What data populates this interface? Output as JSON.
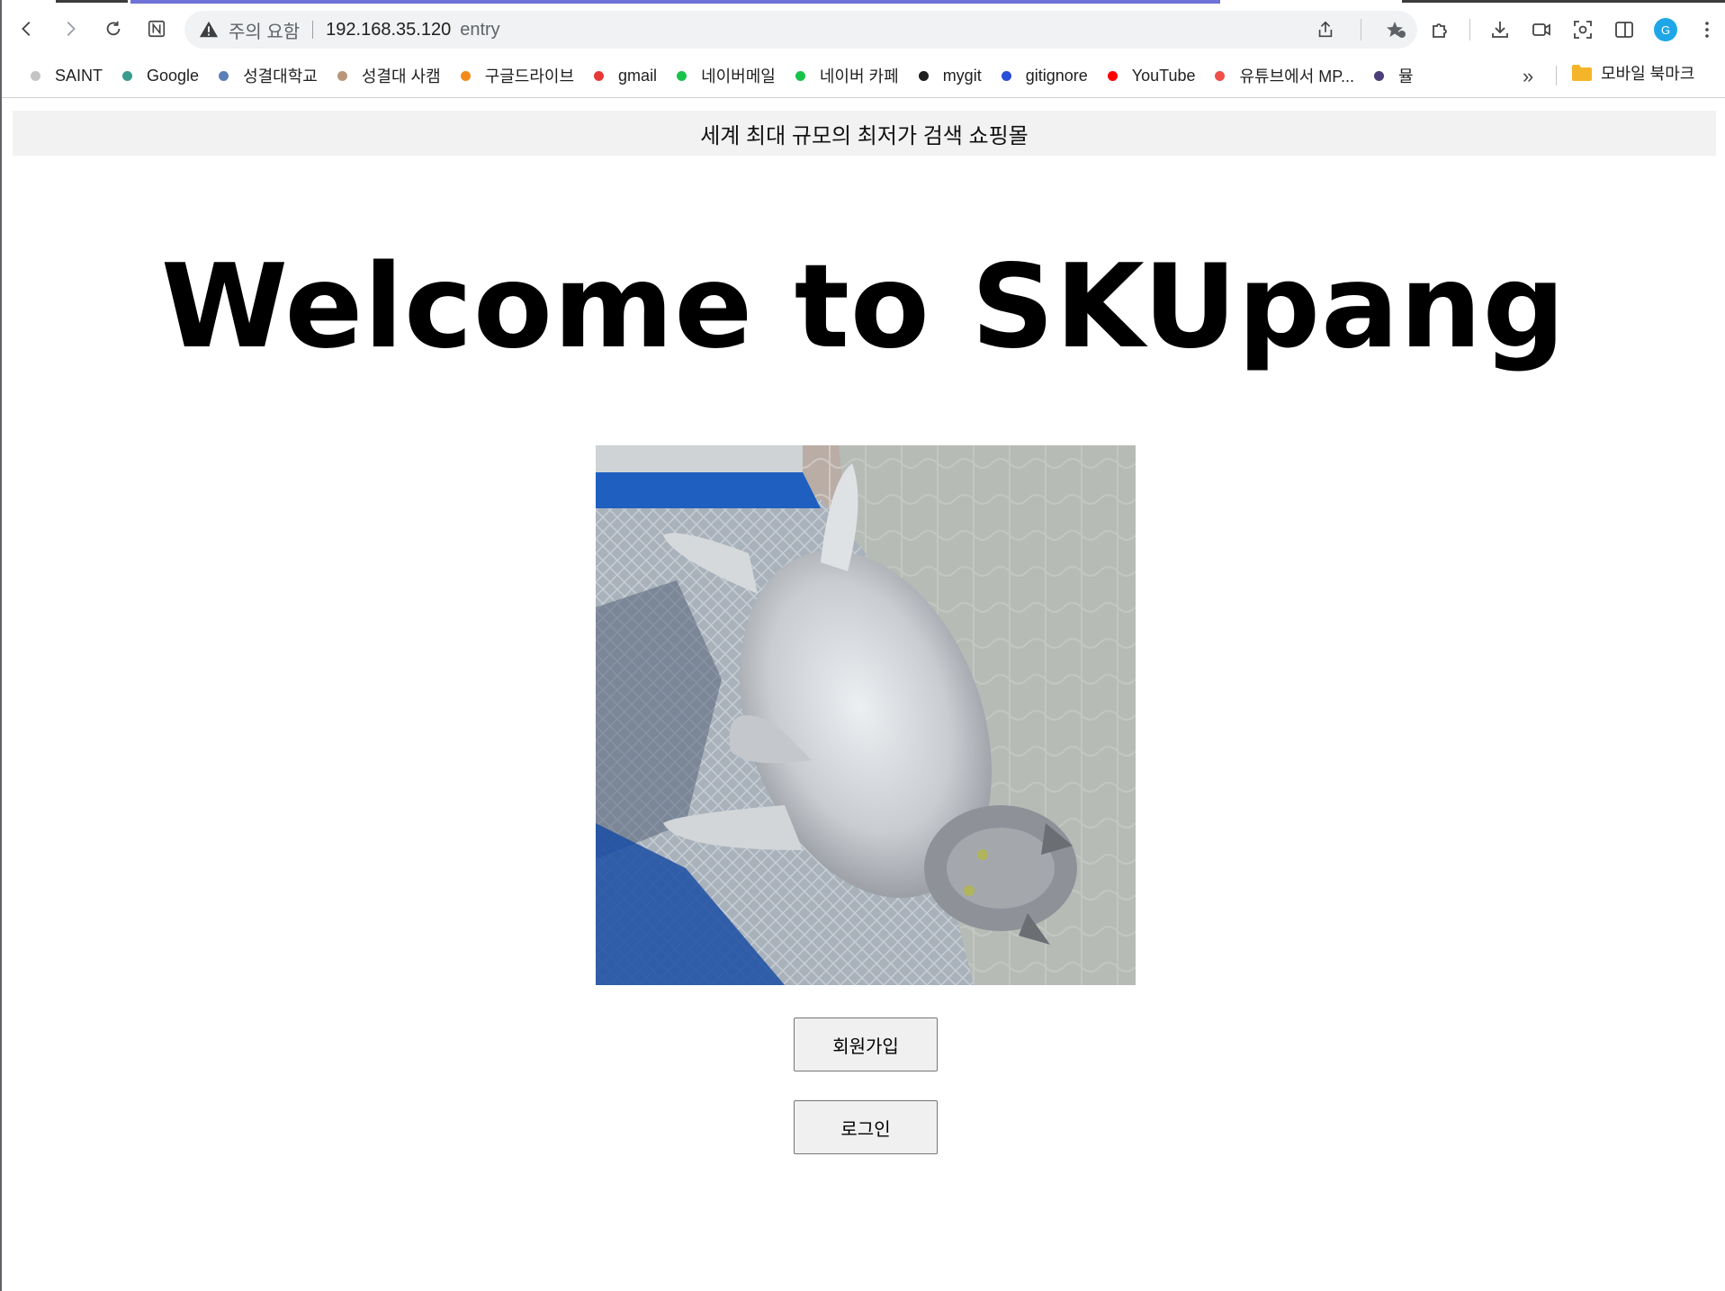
{
  "browser": {
    "security_label": "주의 요함",
    "url_host": "192.168.35.120",
    "url_path": "entry",
    "profile_initial": "G"
  },
  "bookmarks": [
    {
      "label": "SAINT",
      "color": "#c4c4c4"
    },
    {
      "label": "Google",
      "color": "#3a9c8c"
    },
    {
      "label": "성결대학교",
      "color": "#5b7fb6"
    },
    {
      "label": "성결대 사캠",
      "color": "#b9967a"
    },
    {
      "label": "구글드라이브",
      "color": "#f28a1a"
    },
    {
      "label": "gmail",
      "color": "#e53935"
    },
    {
      "label": "네이버메일",
      "color": "#19c34b"
    },
    {
      "label": "네이버 카페",
      "color": "#19c34b"
    },
    {
      "label": "mygit",
      "color": "#1f1f1f"
    },
    {
      "label": "gitignore",
      "color": "#2a4fd6"
    },
    {
      "label": "YouTube",
      "color": "#ff0000"
    },
    {
      "label": "유튜브에서 MP...",
      "color": "#f0504a"
    },
    {
      "label": "뮬",
      "color": "#4a3f78"
    }
  ],
  "bookmarks_folder": "모바일 북마크",
  "page": {
    "banner": "세계 최대 규모의 최저가 검색 쇼핑몰",
    "title": "Welcome to SKUpang",
    "signup_label": "회원가입",
    "login_label": "로그인"
  }
}
